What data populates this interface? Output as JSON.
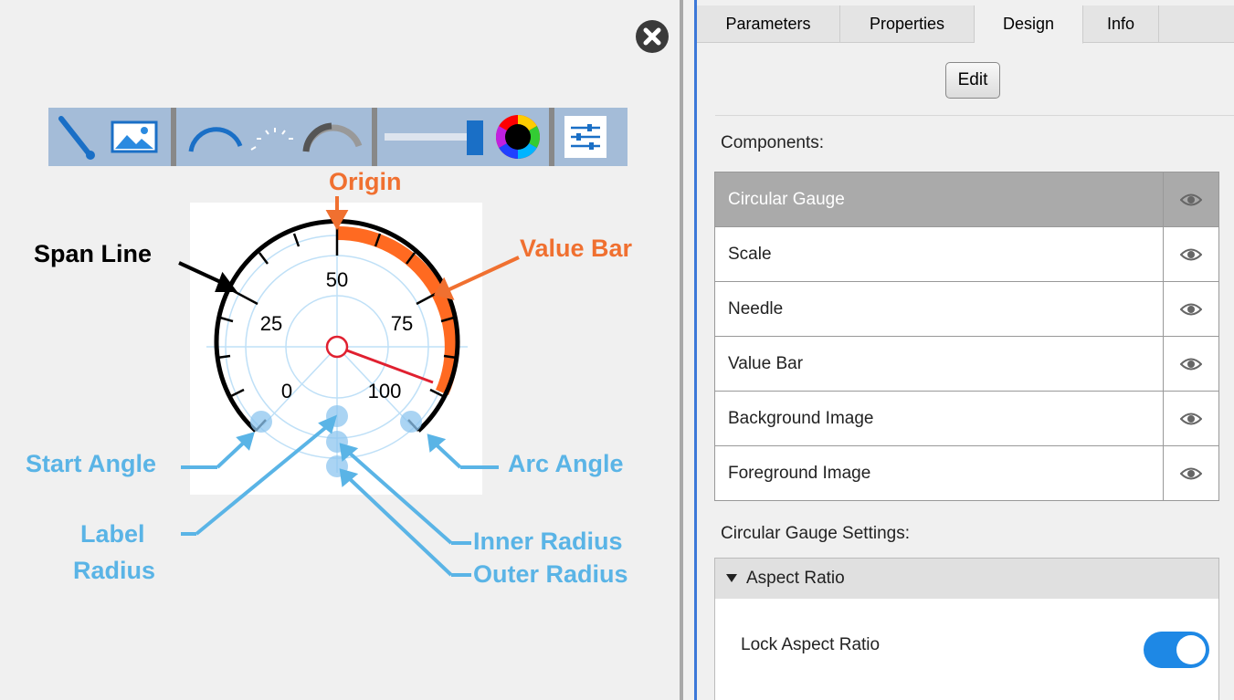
{
  "annotations": {
    "origin": "Origin",
    "span_line": "Span Line",
    "value_bar": "Value Bar",
    "start_angle": "Start Angle",
    "arc_angle": "Arc Angle",
    "label_radius_1": "Label",
    "label_radius_2": "Radius",
    "inner_radius": "Inner Radius",
    "outer_radius": "Outer Radius"
  },
  "gauge": {
    "labels": [
      "0",
      "25",
      "50",
      "75",
      "100"
    ],
    "colors": {
      "value_bar": "#ff6a21",
      "needle": "#e02030",
      "span": "#000000",
      "grid": "#bfe0f7",
      "annotation_blue": "#5ab4e6",
      "annotation_orange": "#f07030"
    }
  },
  "toolbar": {
    "icons": [
      "needle-icon",
      "image-icon",
      "scale-arc-icon",
      "tick-arc-icon",
      "value-bar-arc-icon",
      "slider-icon",
      "color-wheel-icon",
      "settings-icon"
    ]
  },
  "tabs": [
    "Parameters",
    "Properties",
    "Design",
    "Info"
  ],
  "active_tab": "Design",
  "edit_label": "Edit",
  "components_label": "Components:",
  "components": [
    {
      "name": "Circular Gauge",
      "selected": true
    },
    {
      "name": "Scale"
    },
    {
      "name": "Needle"
    },
    {
      "name": "Value Bar"
    },
    {
      "name": "Background Image"
    },
    {
      "name": "Foreground Image"
    }
  ],
  "settings_label": "Circular Gauge Settings:",
  "aspect_ratio": {
    "header": "Aspect Ratio",
    "lock_label": "Lock Aspect Ratio",
    "lock_on": true
  }
}
